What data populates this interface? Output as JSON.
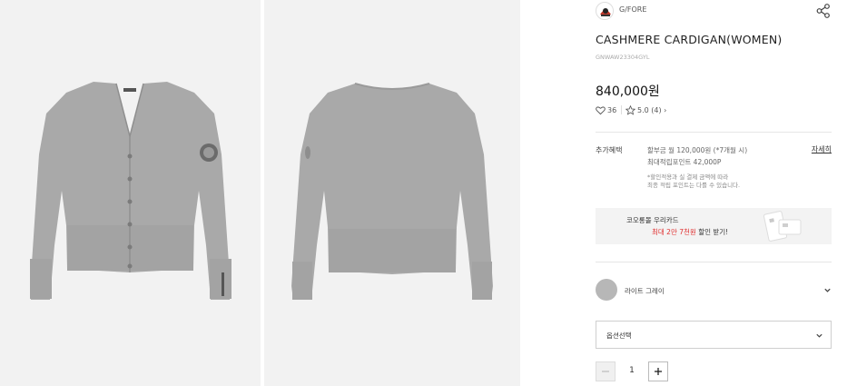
{
  "gallery": {
    "images": [
      {
        "name": "front",
        "icon": "cardigan-front-image"
      },
      {
        "name": "back",
        "icon": "cardigan-back-image"
      }
    ],
    "background": "#f2f2f2",
    "garment_color": "#a9a9a9"
  },
  "brand": {
    "name": "G/FORE",
    "logo_icon": "brand-logo-icon"
  },
  "product": {
    "title": "CASHMERE CARDIGAN(WOMEN)",
    "sku": "GNWAW23304GYL",
    "price": "840,000원",
    "likes": "36",
    "rating": "5.0 (4)",
    "rating_arrow": "›"
  },
  "benefits": {
    "label": "추가혜택",
    "installment": "할부금 월 120,000원 (*7개월 시)",
    "points": "최대적립포인트 42,000P",
    "note_line1": "*할인적용과 실 결제 금액에 따라",
    "note_line2": "최종 적립 포인트는 다를 수 있습니다.",
    "detail_link": "자세히"
  },
  "card_banner": {
    "line1": "코오롱몰 우리카드",
    "line2_red": "최대 2만 7천원",
    "line2_rest": " 할인 받기!",
    "accent": "#e03030"
  },
  "color_option": {
    "name": "라이트 그레이",
    "swatch": "#b7b7b7"
  },
  "option_select": {
    "placeholder": "옵션선택"
  },
  "quantity": {
    "value": "1"
  }
}
